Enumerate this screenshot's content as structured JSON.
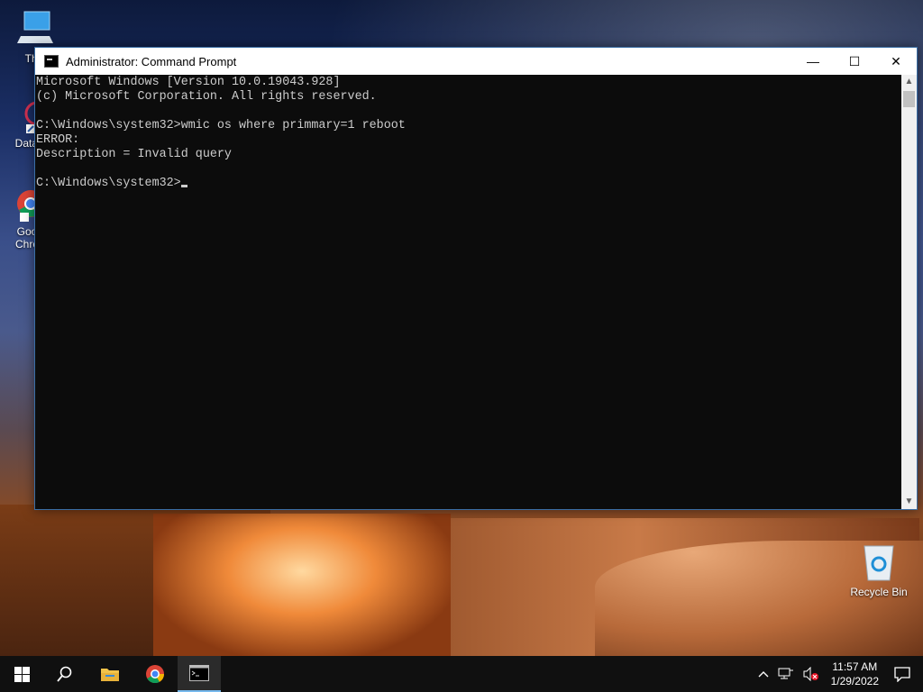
{
  "desktop": {
    "icons": [
      {
        "label": "This"
      },
      {
        "label": "DataW"
      },
      {
        "label": "Goo Chro"
      },
      {
        "label": "Recycle Bin"
      }
    ]
  },
  "window": {
    "title": "Administrator: Command Prompt",
    "minimize": "—",
    "maximize": "☐",
    "close": "✕",
    "lines": [
      "Microsoft Windows [Version 10.0.19043.928]",
      "(c) Microsoft Corporation. All rights reserved.",
      "",
      "C:\\Windows\\system32>wmic os where primmary=1 reboot",
      "ERROR:",
      "Description = Invalid query",
      ""
    ],
    "prompt": "C:\\Windows\\system32>"
  },
  "taskbar": {
    "time": "11:57 AM",
    "date": "1/29/2022"
  }
}
